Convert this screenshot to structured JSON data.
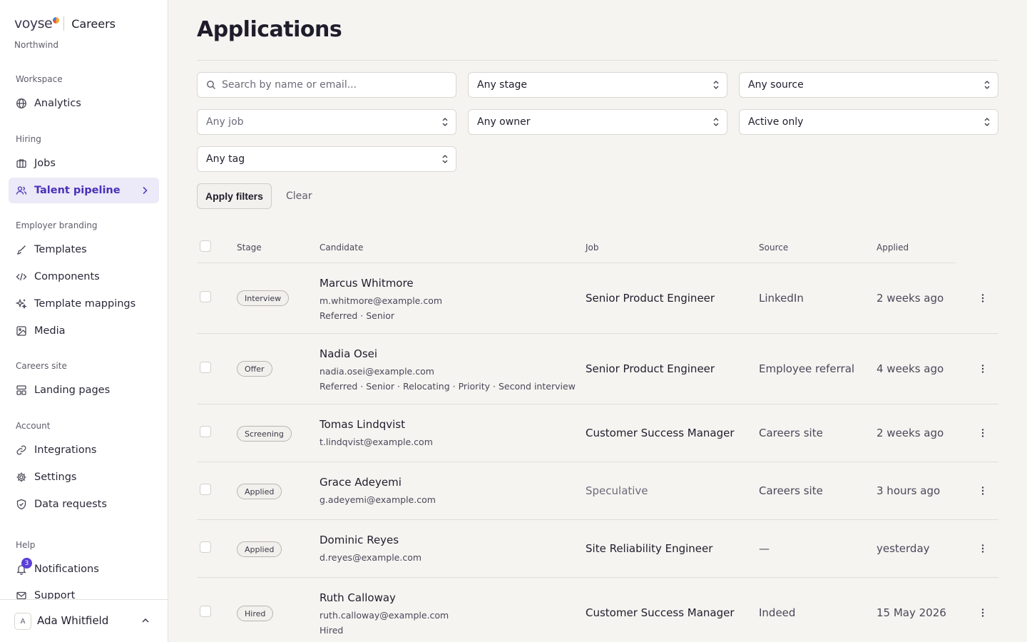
{
  "brand": {
    "logo": "voyse",
    "product": "Careers",
    "org": "Northwind"
  },
  "sidebar": {
    "sections": {
      "workspace": "Workspace",
      "hiring": "Hiring",
      "branding": "Employer branding",
      "careers": "Careers site",
      "account": "Account",
      "help": "Help"
    },
    "items": {
      "analytics": "Analytics",
      "jobs": "Jobs",
      "pipeline": "Talent pipeline",
      "templates": "Templates",
      "components": "Components",
      "mappings": "Template mappings",
      "media": "Media",
      "landing": "Landing pages",
      "integrations": "Integrations",
      "settings": "Settings",
      "data_requests": "Data requests",
      "notifications": "Notifications",
      "support": "Support"
    },
    "notifications_count": "3",
    "user": {
      "initial": "A",
      "name": "Ada Whitfield"
    }
  },
  "page": {
    "title": "Applications"
  },
  "filters": {
    "search_placeholder": "Search by name or email...",
    "stage": "Any stage",
    "source": "Any source",
    "job": "Any job",
    "owner": "Any owner",
    "status": "Active only",
    "tag": "Any tag",
    "apply_label": "Apply filters",
    "clear_label": "Clear"
  },
  "table": {
    "headers": {
      "stage": "Stage",
      "candidate": "Candidate",
      "job": "Job",
      "source": "Source",
      "applied": "Applied"
    },
    "rows": [
      {
        "stage": "Interview",
        "name": "Marcus Whitmore",
        "email": "m.whitmore@example.com",
        "tags": "Referred · Senior",
        "job": "Senior Product Engineer",
        "source": "LinkedIn",
        "applied": "2 weeks ago"
      },
      {
        "stage": "Offer",
        "name": "Nadia Osei",
        "email": "nadia.osei@example.com",
        "tags": "Referred · Senior · Relocating · Priority · Second interview",
        "job": "Senior Product Engineer",
        "source": "Employee referral",
        "applied": "4 weeks ago"
      },
      {
        "stage": "Screening",
        "name": "Tomas Lindqvist",
        "email": "t.lindqvist@example.com",
        "tags": "",
        "job": "Customer Success Manager",
        "source": "Careers site",
        "applied": "2 weeks ago"
      },
      {
        "stage": "Applied",
        "name": "Grace Adeyemi",
        "email": "g.adeyemi@example.com",
        "tags": "",
        "job": "Speculative",
        "source": "Careers site",
        "applied": "3 hours ago"
      },
      {
        "stage": "Applied",
        "name": "Dominic Reyes",
        "email": "d.reyes@example.com",
        "tags": "",
        "job": "Site Reliability Engineer",
        "source": "—",
        "applied": "yesterday"
      },
      {
        "stage": "Hired",
        "name": "Ruth Calloway",
        "email": "ruth.calloway@example.com",
        "tags": "Hired",
        "job": "Customer Success Manager",
        "source": "Indeed",
        "applied": "15 May 2026"
      }
    ]
  },
  "colors": {
    "accent": "#4a31b8",
    "active_bg": "#ece9f8",
    "badge": "#5a3fd8",
    "background": "#f5f4f1"
  }
}
